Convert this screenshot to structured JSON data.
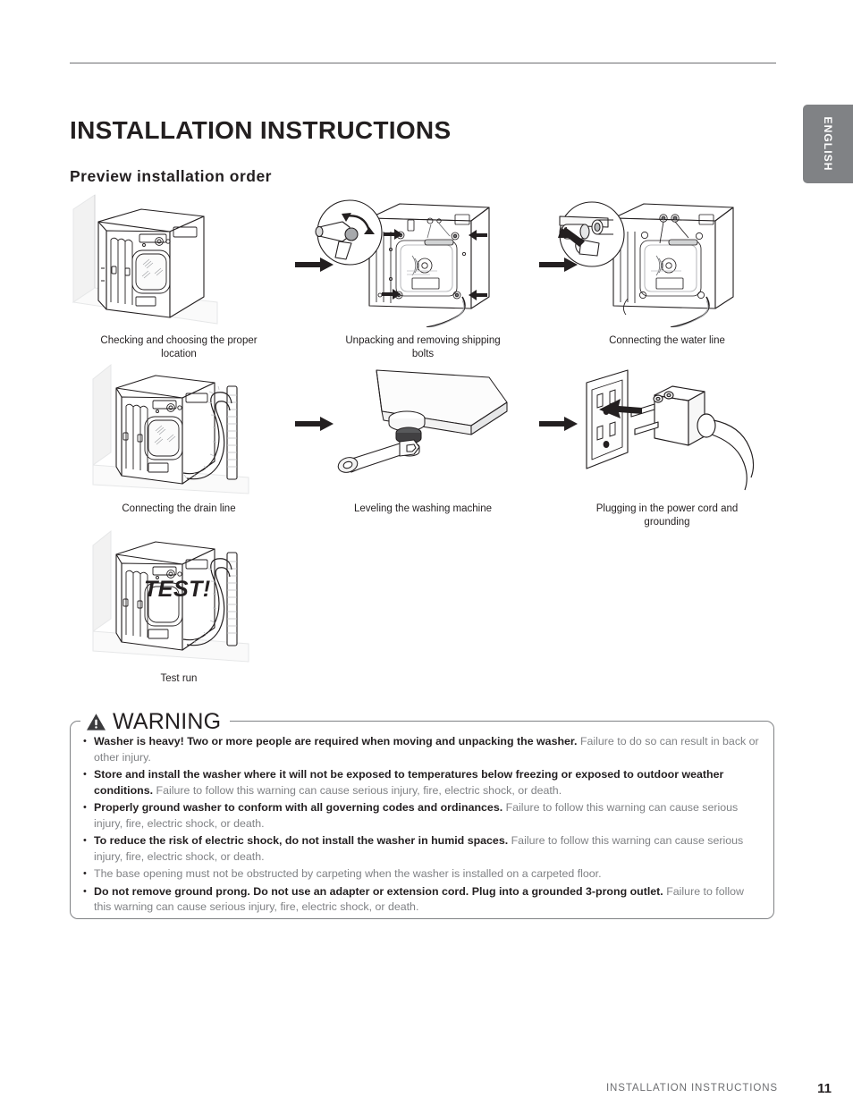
{
  "header": {
    "title": "INSTALLATION INSTRUCTIONS",
    "page_number": "11"
  },
  "lang_tab": {
    "label": "ENGLISH"
  },
  "chapter_title": "INSTALLATION INSTRUCTIONS",
  "section_title": "Preview installation order",
  "flow": {
    "steps": [
      {
        "caption": "Checking and choosing the proper location",
        "art": "washer-in-corner"
      },
      {
        "caption": "Unpacking and removing shipping bolts",
        "art": "washer-rear-shipping-bolts"
      },
      {
        "caption": "Connecting the water line",
        "art": "washer-rear-water-line"
      },
      {
        "caption": "Connecting the drain line",
        "art": "washer-drain-hose"
      },
      {
        "caption": "Leveling the washing machine",
        "art": "leveling-foot-wrench"
      },
      {
        "caption": "Plugging in the power cord and grounding",
        "art": "wall-outlet-plug"
      },
      {
        "caption": "Test run",
        "art": "washer-test-run"
      }
    ],
    "test_overlay_text": "TEST!"
  },
  "warning": {
    "heading": "WARNING",
    "items": [
      {
        "lead": "Washer is heavy! Two or more people are required when moving and unpacking the washer.",
        "rest": " Failure to do so can result in back or other injury."
      },
      {
        "lead": "Store and install the washer where it will not be exposed to temperatures below freezing or exposed to outdoor weather conditions.",
        "rest": " Failure to follow this warning can cause serious injury, fire, electric shock, or death."
      },
      {
        "lead": "Properly ground washer to conform with all governing codes and ordinances.",
        "rest": " Failure to follow this warning can cause serious injury, fire, electric shock, or death."
      },
      {
        "lead": "To reduce the risk of electric shock, do not install the washer in humid spaces.",
        "rest": " Failure to follow this warning can cause serious injury, fire, electric shock, or death."
      },
      {
        "lead": "",
        "rest": "The base opening must not be obstructed by carpeting when the washer is installed on a carpeted floor."
      },
      {
        "lead": "Do not remove ground prong. Do not use an adapter or extension cord. Plug into a grounded 3-prong outlet.",
        "rest": " Failure to follow this warning can cause serious injury, fire, electric shock, or death."
      }
    ]
  },
  "colors": {
    "text": "#231f20",
    "muted": "#808285",
    "tab_bg": "#808285",
    "line": "#6d6e71"
  }
}
